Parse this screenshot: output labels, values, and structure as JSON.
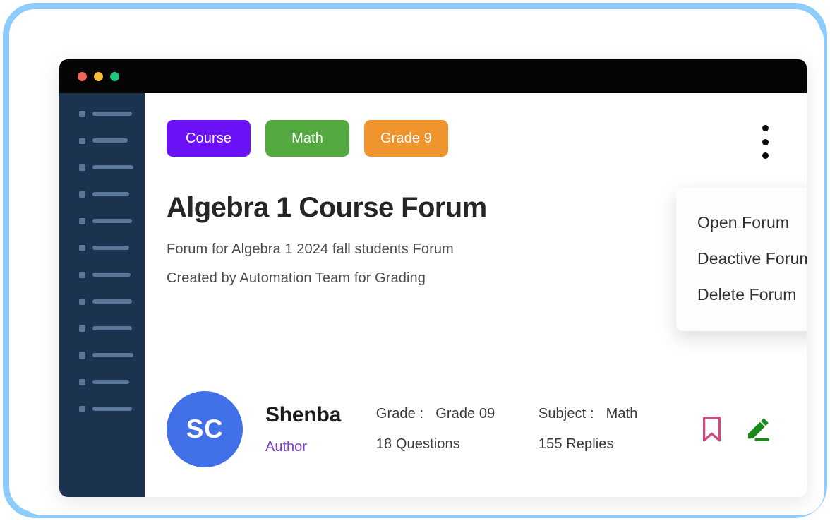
{
  "window": {
    "traffic_lights": [
      {
        "name": "close",
        "color": "#f4635c"
      },
      {
        "name": "minimize",
        "color": "#f5bd3c"
      },
      {
        "name": "maximize",
        "color": "#1fc77e"
      }
    ]
  },
  "sidebar": {
    "background": "#1c3350",
    "placeholder_color": "#5a779a",
    "items": [
      {
        "width": 56
      },
      {
        "width": 50
      },
      {
        "width": 58
      },
      {
        "width": 52
      },
      {
        "width": 56
      },
      {
        "width": 52
      },
      {
        "width": 54
      },
      {
        "width": 56
      },
      {
        "width": 56
      },
      {
        "width": 58
      },
      {
        "width": 52
      },
      {
        "width": 56
      }
    ]
  },
  "tags": [
    {
      "label": "Course",
      "color": "#6b11f5"
    },
    {
      "label": "Math",
      "color": "#53a93f"
    },
    {
      "label": "Grade 9",
      "color": "#f0952e"
    }
  ],
  "header": {
    "title": "Algebra 1 Course Forum",
    "description_lines": [
      "Forum for Algebra 1 2024 fall students Forum",
      "Created by Automation Team for Grading"
    ]
  },
  "menu": {
    "trigger_icon": "kebab-menu-icon",
    "items": [
      {
        "label": "Open Forum"
      },
      {
        "label": "Deactive Forum"
      },
      {
        "label": "Delete Forum"
      }
    ]
  },
  "author": {
    "initials": "SC",
    "avatar_color": "#4270e8",
    "name": "Shenba",
    "role": "Author",
    "role_color": "#7c3fd0"
  },
  "stats": {
    "grade_label": "Grade :",
    "grade_value": "Grade 09",
    "questions": "18 Questions",
    "subject_label": "Subject :",
    "subject_value": "Math",
    "replies": "155 Replies"
  },
  "actions": {
    "bookmark": {
      "icon": "bookmark-icon",
      "color": "#d4497c"
    },
    "edit": {
      "icon": "pencil-edit-icon",
      "color": "#1a8a1a"
    }
  }
}
